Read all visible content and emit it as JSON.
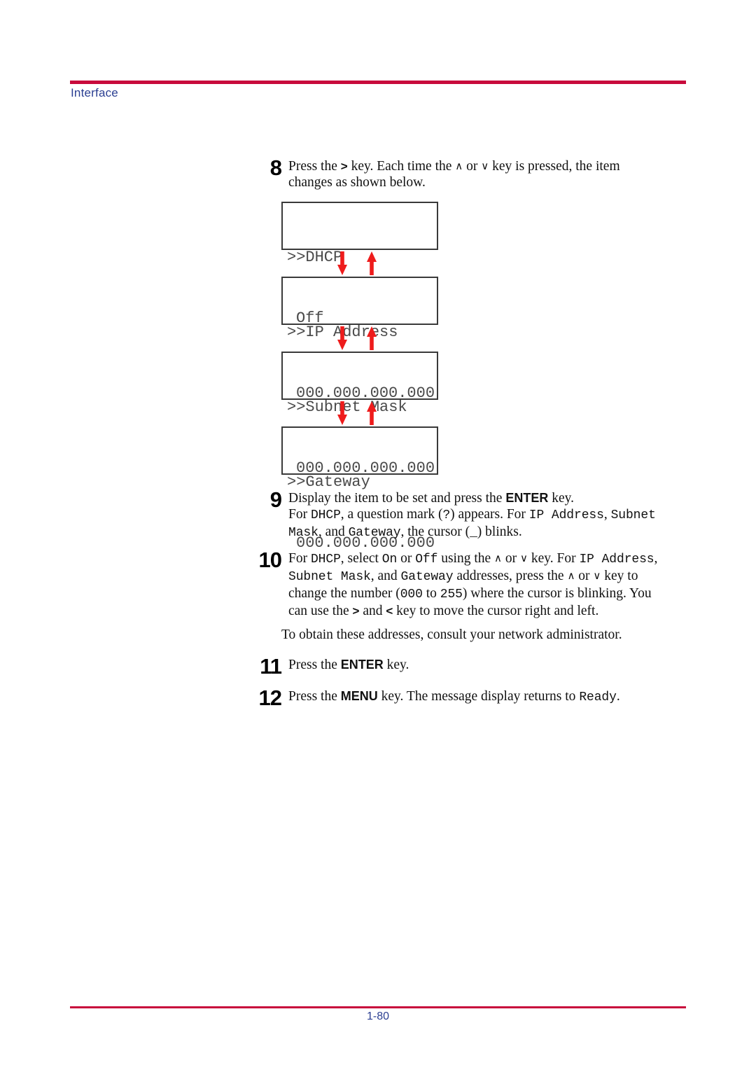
{
  "header": {
    "label": "Interface",
    "rule_color": "#c80a3c",
    "text_color": "#2b3f92"
  },
  "footer": {
    "page_number": "1-80",
    "rule_color": "#c80a3c",
    "text_color": "#2b3f92"
  },
  "steps": {
    "s8": {
      "number": "8",
      "line1_a": "Press the ",
      "line1_gt": ">",
      "line1_b": " key. Each time the ",
      "line1_up": "∧",
      "line1_c": " or ",
      "line1_dn": "∨",
      "line1_d": " key is pressed, the item",
      "line2": "changes as shown below."
    },
    "s9": {
      "number": "9",
      "l1_a": "Display the item to be set and press the ",
      "l1_key": "ENTER",
      "l1_b": " key.",
      "l2_a": "For ",
      "l2_m1": "DHCP",
      "l2_b": ", a question mark (",
      "l2_m2": "?",
      "l2_c": ") appears. For ",
      "l2_m3": "IP Address",
      "l2_d": ", ",
      "l2_m4": "Subnet",
      "l3_m1": "Mask",
      "l3_a": ", and ",
      "l3_m2": "Gateway",
      "l3_b": ", the cursor (",
      "l3_m3": "_",
      "l3_c": ") blinks."
    },
    "s10": {
      "number": "10",
      "l1_a": "For ",
      "l1_m1": "DHCP",
      "l1_b": ", select ",
      "l1_m2": "On",
      "l1_c": " or ",
      "l1_m3": "Off",
      "l1_d": " using the ",
      "l1_up": "∧",
      "l1_e": " or ",
      "l1_dn": "∨",
      "l1_f": " key. For ",
      "l1_m4": "IP Address",
      "l1_g": ",",
      "l2_m1": "Subnet Mask",
      "l2_a": ", and ",
      "l2_m2": "Gateway",
      "l2_b": " addresses, press the ",
      "l2_up": "∧",
      "l2_c": " or ",
      "l2_dn": "∨",
      "l2_d": " key to",
      "l3_a": "change the number (",
      "l3_m1": "000",
      "l3_b": " to ",
      "l3_m2": "255",
      "l3_c": ") where the cursor is blinking. You",
      "l4_a": "can use the ",
      "l4_gt": ">",
      "l4_b": " and ",
      "l4_lt": "<",
      "l4_c": " key to move the cursor right and left."
    },
    "note": "To obtain these addresses, consult your network administrator.",
    "s11": {
      "number": "11",
      "l1_a": "Press the ",
      "l1_key": "ENTER",
      "l1_b": " key."
    },
    "s12": {
      "number": "12",
      "l1_a": "Press the ",
      "l1_key": "MENU",
      "l1_b": " key. The message display returns to ",
      "l1_m1": "Ready",
      "l1_c": "."
    }
  },
  "lcd_diagram": {
    "arrow_color": "#ee1c1c",
    "border_color": "#3a3a3a",
    "text_color": "#4a4a4a",
    "screens": [
      {
        "line1": ">>DHCP",
        "line2": "Off"
      },
      {
        "line1": ">>IP Address",
        "line2": "000.000.000.000"
      },
      {
        "line1": ">>Subnet Mask",
        "line2": "000.000.000.000"
      },
      {
        "line1": ">>Gateway",
        "line2": "000.000.000.000"
      }
    ]
  }
}
